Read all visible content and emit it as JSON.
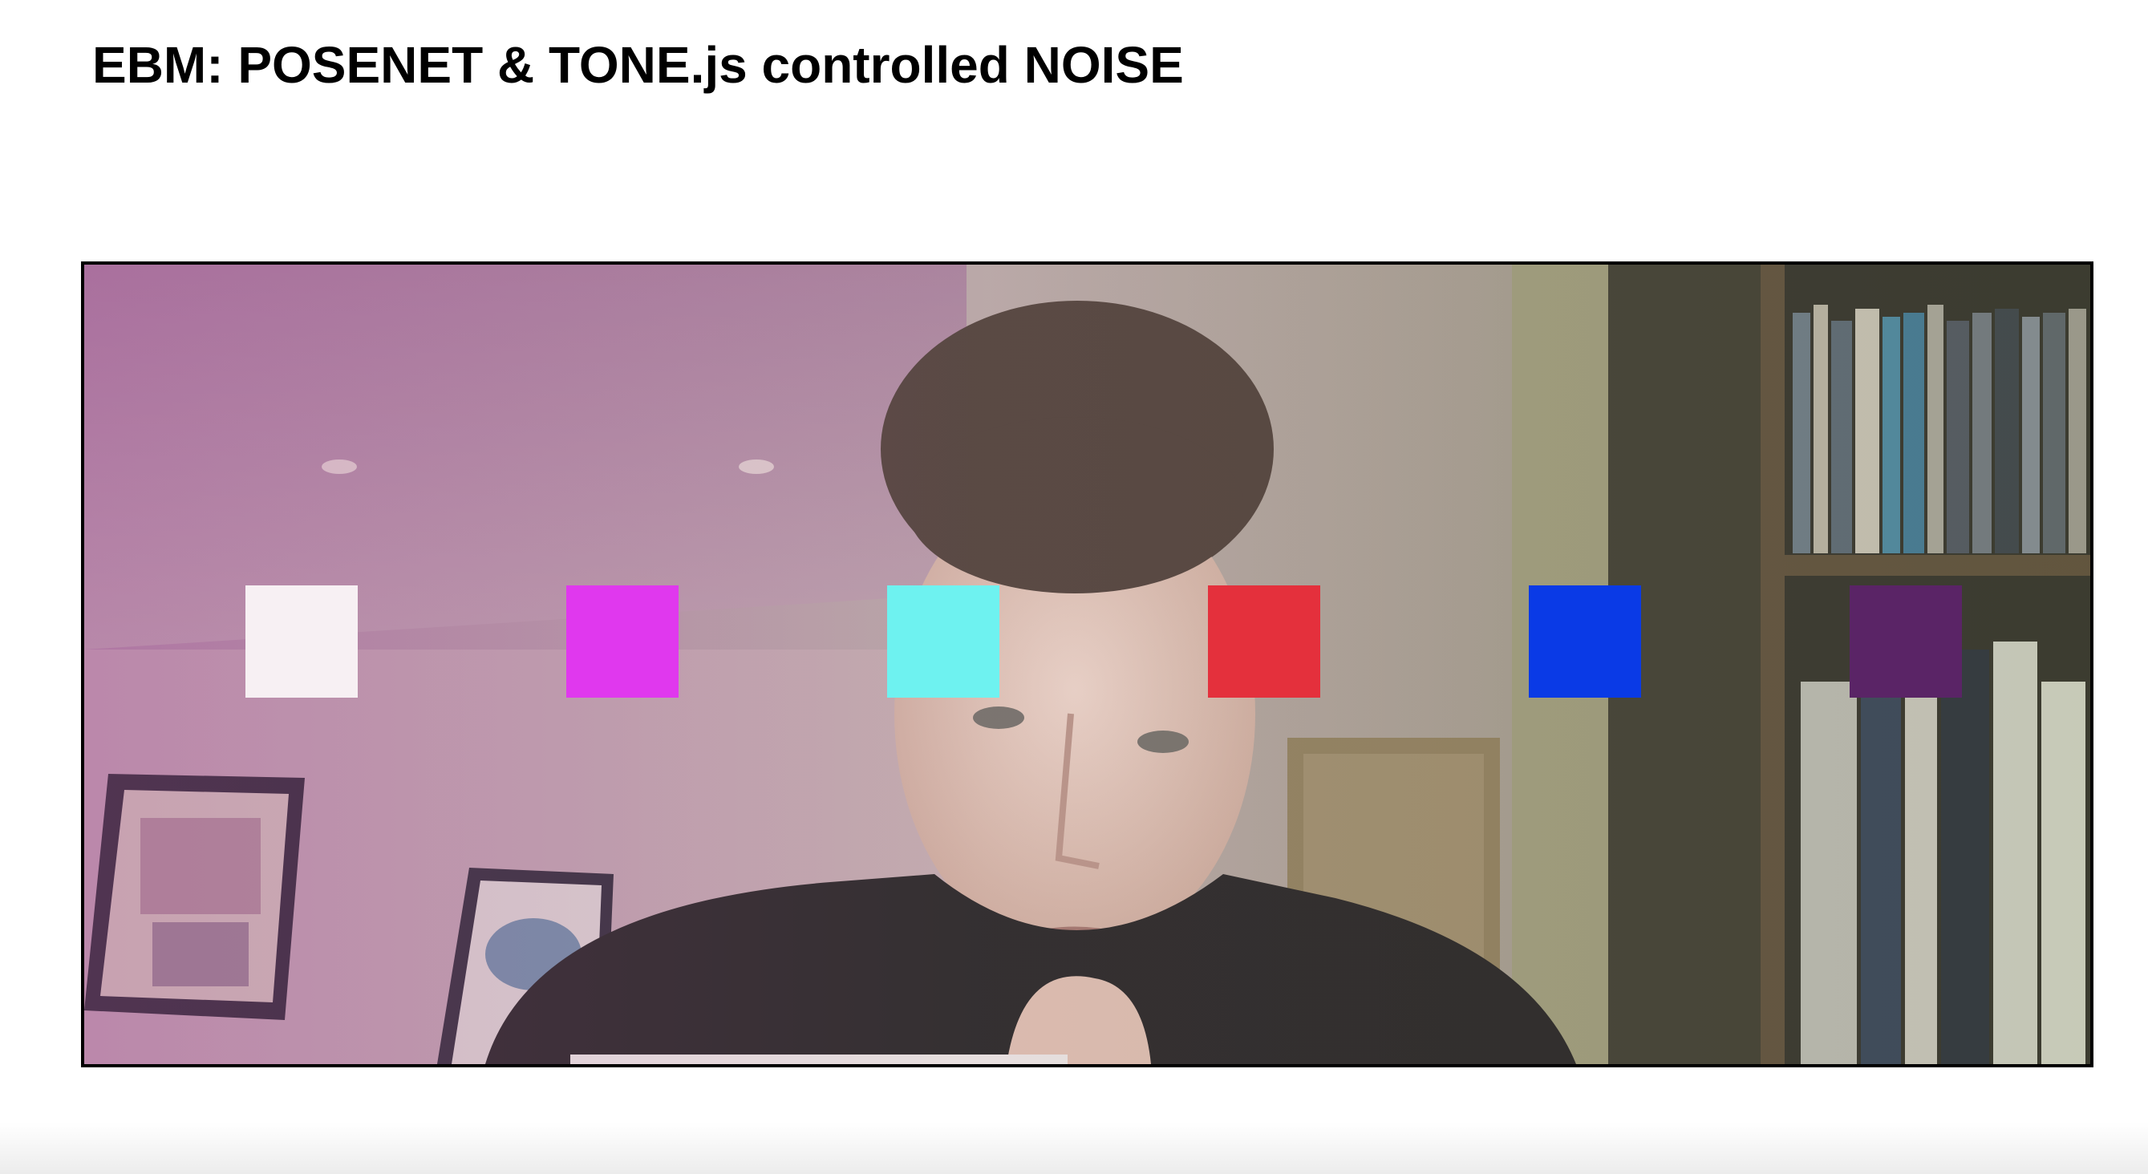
{
  "page": {
    "title": "EBM: POSENET & TONE.js controlled NOISE"
  },
  "video": {
    "icon": "webcam-feed",
    "tint_colors": [
      "#b07aa8",
      "#a99a86",
      "#7e8f74"
    ]
  },
  "pads": [
    {
      "name": "pad-white",
      "color": "#f7f0f3"
    },
    {
      "name": "pad-magenta",
      "color": "#e038ee"
    },
    {
      "name": "pad-cyan",
      "color": "#6ef2f0"
    },
    {
      "name": "pad-red",
      "color": "#e4303c"
    },
    {
      "name": "pad-blue",
      "color": "#0a3ae6"
    },
    {
      "name": "pad-purple",
      "color": "#5a2466"
    }
  ]
}
